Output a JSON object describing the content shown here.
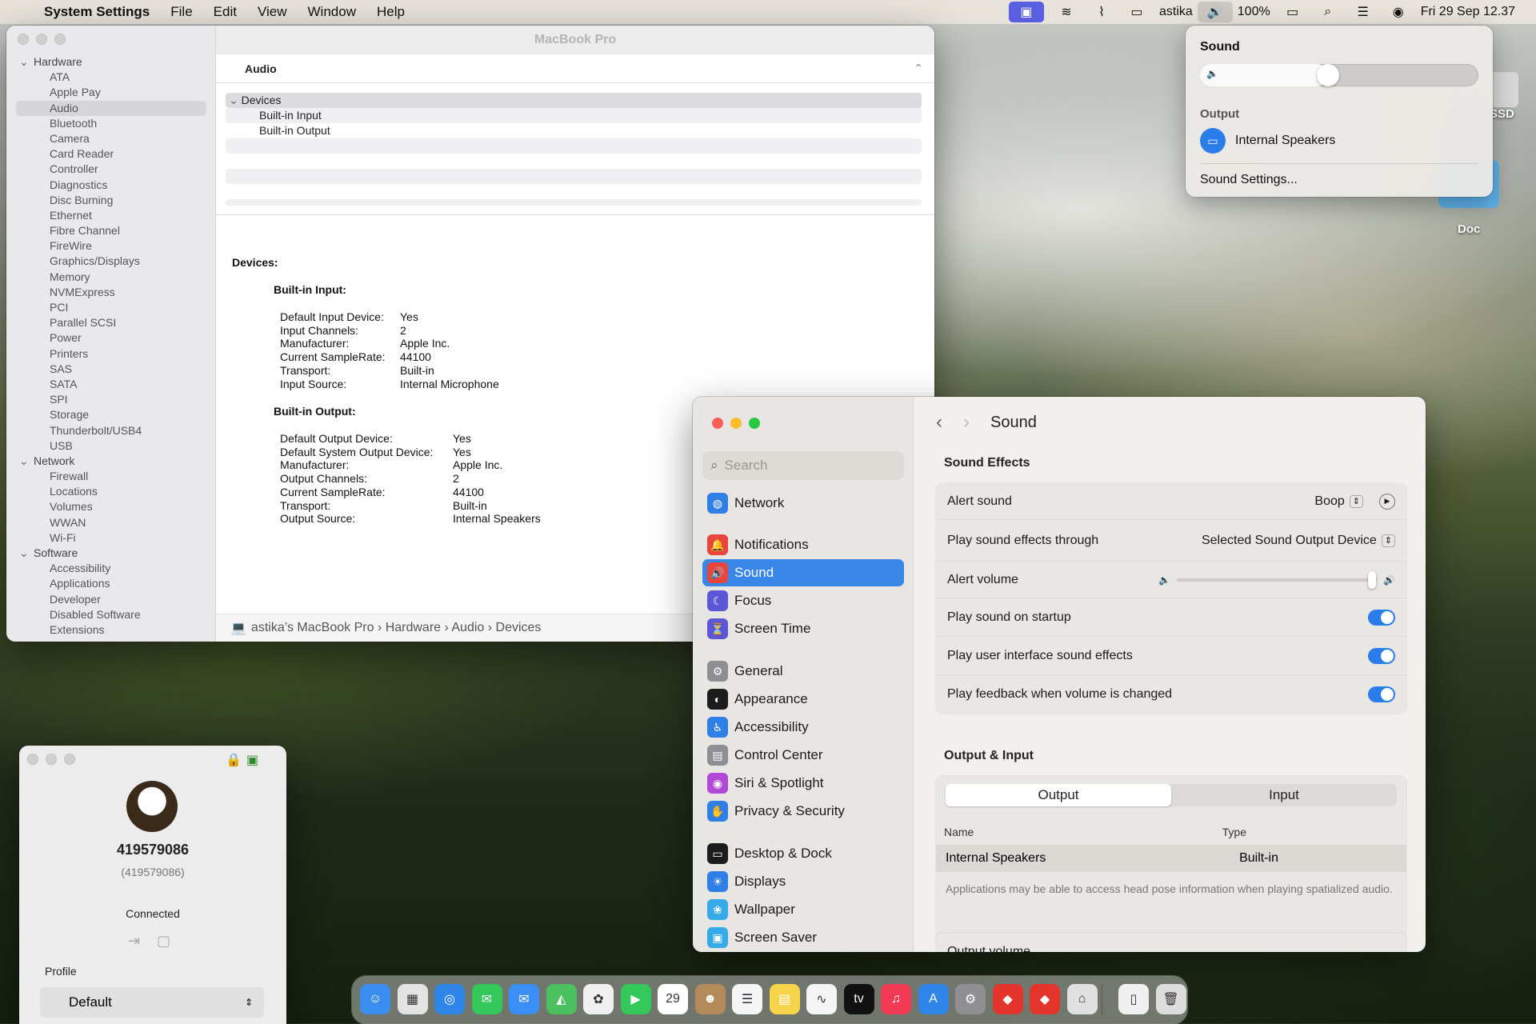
{
  "menubar": {
    "app": "System Settings",
    "items": [
      "File",
      "Edit",
      "Window",
      "Help"
    ],
    "view": "View",
    "user": "astika",
    "battery": "100%",
    "datetime": "Fri 29 Sep  12.37"
  },
  "sound_popup": {
    "title": "Sound",
    "volume": 0.42,
    "output_label": "Output",
    "device": "Internal Speakers",
    "settings_link": "Sound Settings..."
  },
  "desktop": {
    "ssd_label": "SSD",
    "doc_label": "Doc"
  },
  "sysinfo": {
    "window_title": "MacBook Pro",
    "section": "Audio",
    "tree": [
      {
        "t": "Hardware",
        "g": true
      },
      {
        "t": "ATA"
      },
      {
        "t": "Apple Pay"
      },
      {
        "t": "Audio",
        "sel": true
      },
      {
        "t": "Bluetooth"
      },
      {
        "t": "Camera"
      },
      {
        "t": "Card Reader"
      },
      {
        "t": "Controller"
      },
      {
        "t": "Diagnostics"
      },
      {
        "t": "Disc Burning"
      },
      {
        "t": "Ethernet"
      },
      {
        "t": "Fibre Channel"
      },
      {
        "t": "FireWire"
      },
      {
        "t": "Graphics/Displays"
      },
      {
        "t": "Memory"
      },
      {
        "t": "NVMExpress"
      },
      {
        "t": "PCI"
      },
      {
        "t": "Parallel SCSI"
      },
      {
        "t": "Power"
      },
      {
        "t": "Printers"
      },
      {
        "t": "SAS"
      },
      {
        "t": "SATA"
      },
      {
        "t": "SPI"
      },
      {
        "t": "Storage"
      },
      {
        "t": "Thunderbolt/USB4"
      },
      {
        "t": "USB"
      },
      {
        "t": "Network",
        "g": true
      },
      {
        "t": "Firewall"
      },
      {
        "t": "Locations"
      },
      {
        "t": "Volumes"
      },
      {
        "t": "WWAN"
      },
      {
        "t": "Wi-Fi"
      },
      {
        "t": "Software",
        "g": true
      },
      {
        "t": "Accessibility"
      },
      {
        "t": "Applications"
      },
      {
        "t": "Developer"
      },
      {
        "t": "Disabled Software"
      },
      {
        "t": "Extensions"
      }
    ],
    "list": {
      "devices": "Devices",
      "input": "Built-in Input",
      "output": "Built-in Output"
    },
    "detail": {
      "heading": "Devices:",
      "input_title": "Built-in Input:",
      "input_kv": [
        [
          "Default Input Device:",
          "Yes"
        ],
        [
          "Input Channels:",
          "2"
        ],
        [
          "Manufacturer:",
          "Apple Inc."
        ],
        [
          "Current SampleRate:",
          "44100"
        ],
        [
          "Transport:",
          "Built-in"
        ],
        [
          "Input Source:",
          "Internal Microphone"
        ]
      ],
      "output_title": "Built-in Output:",
      "output_kv": [
        [
          "Default Output Device:",
          "Yes"
        ],
        [
          "Default System Output Device:",
          "Yes"
        ],
        [
          "Manufacturer:",
          "Apple Inc."
        ],
        [
          "Output Channels:",
          "2"
        ],
        [
          "Current SampleRate:",
          "44100"
        ],
        [
          "Transport:",
          "Built-in"
        ],
        [
          "Output Source:",
          "Internal Speakers"
        ]
      ]
    },
    "breadcrumb": "astika’s MacBook Pro › Hardware › Audio › Devices"
  },
  "settings": {
    "search_placeholder": "Search",
    "title": "Sound",
    "nav": [
      {
        "label": "Network",
        "color": "#2f7fe6",
        "icon": "globe-icon",
        "glyph": "◍"
      },
      {
        "label": "Notifications",
        "color": "#e8453c",
        "icon": "bell-icon",
        "glyph": "🔔"
      },
      {
        "label": "Sound",
        "color": "#e8453c",
        "icon": "speaker-icon",
        "glyph": "🔊",
        "on": true
      },
      {
        "label": "Focus",
        "color": "#5b57d6",
        "icon": "moon-icon",
        "glyph": "☾"
      },
      {
        "label": "Screen Time",
        "color": "#5b57d6",
        "icon": "hourglass-icon",
        "glyph": "⏳"
      },
      {
        "label": "General",
        "color": "#8e8e93",
        "icon": "gear-icon",
        "glyph": "⚙"
      },
      {
        "label": "Appearance",
        "color": "#1c1c1e",
        "icon": "appearance-icon",
        "glyph": "◐"
      },
      {
        "label": "Accessibility",
        "color": "#2f7fe6",
        "icon": "accessibility-icon",
        "glyph": "♿"
      },
      {
        "label": "Control Center",
        "color": "#8e8e93",
        "icon": "control-center-icon",
        "glyph": "▤"
      },
      {
        "label": "Siri & Spotlight",
        "color": "#b04ad6",
        "icon": "siri-icon",
        "glyph": "◉"
      },
      {
        "label": "Privacy & Security",
        "color": "#2f7fe6",
        "icon": "hand-icon",
        "glyph": "✋"
      },
      {
        "label": "Desktop & Dock",
        "color": "#1c1c1e",
        "icon": "dock-icon",
        "glyph": "▭"
      },
      {
        "label": "Displays",
        "color": "#2f7fe6",
        "icon": "display-icon",
        "glyph": "☀"
      },
      {
        "label": "Wallpaper",
        "color": "#36a9e8",
        "icon": "wallpaper-icon",
        "glyph": "❀"
      },
      {
        "label": "Screen Saver",
        "color": "#36a9e8",
        "icon": "screensaver-icon",
        "glyph": "▣"
      }
    ],
    "effects_title": "Sound Effects",
    "alert_sound": {
      "label": "Alert sound",
      "value": "Boop"
    },
    "play_through": {
      "label": "Play sound effects through",
      "value": "Selected Sound Output Device"
    },
    "alert_volume": {
      "label": "Alert volume",
      "value": 1.0
    },
    "toggles": [
      {
        "label": "Play sound on startup",
        "on": true
      },
      {
        "label": "Play user interface sound effects",
        "on": true
      },
      {
        "label": "Play feedback when volume is changed",
        "on": true
      }
    ],
    "oi_title": "Output & Input",
    "tabs": {
      "output": "Output",
      "input": "Input"
    },
    "table": {
      "col_name": "Name",
      "col_type": "Type",
      "row_name": "Internal Speakers",
      "row_type": "Built-in"
    },
    "note": "Applications may be able to access head pose information when playing spatialized audio.",
    "output_volume": "Output volume"
  },
  "teamviewer": {
    "id": "419579086",
    "id_paren": "(419579086)",
    "status": "Connected",
    "profile_label": "Profile",
    "profile_value": "Default"
  },
  "dock": {
    "apps": [
      {
        "n": "finder-icon",
        "c": "#3b8ef0",
        "g": "☺"
      },
      {
        "n": "launchpad-icon",
        "c": "#e3e3e3",
        "g": "▦"
      },
      {
        "n": "safari-icon",
        "c": "#2f86e8",
        "g": "◎"
      },
      {
        "n": "messages-icon",
        "c": "#34c759",
        "g": "✉"
      },
      {
        "n": "mail-icon",
        "c": "#3a8ef5",
        "g": "✉"
      },
      {
        "n": "maps-icon",
        "c": "#4cbf5f",
        "g": "◭"
      },
      {
        "n": "photos-icon",
        "c": "#f0f0f0",
        "g": "✿"
      },
      {
        "n": "facetime-icon",
        "c": "#34c759",
        "g": "▶"
      },
      {
        "n": "calendar-icon",
        "c": "#ffffff",
        "g": "29"
      },
      {
        "n": "contacts-icon",
        "c": "#b58a5a",
        "g": "☻"
      },
      {
        "n": "reminders-icon",
        "c": "#f5f5f5",
        "g": "☰"
      },
      {
        "n": "notes-icon",
        "c": "#f7d44a",
        "g": "▤"
      },
      {
        "n": "freeform-icon",
        "c": "#f5f5f5",
        "g": "∿"
      },
      {
        "n": "tv-icon",
        "c": "#111111",
        "g": "tv"
      },
      {
        "n": "music-icon",
        "c": "#f33a55",
        "g": "♫"
      },
      {
        "n": "app-store-icon",
        "c": "#2f86e8",
        "g": "A"
      },
      {
        "n": "system-settings-icon",
        "c": "#8e8e93",
        "g": "⚙"
      },
      {
        "n": "anydesk-icon",
        "c": "#e5342b",
        "g": "◆"
      },
      {
        "n": "anydesk-alt-icon",
        "c": "#e5342b",
        "g": "◆"
      },
      {
        "n": "preview-icon",
        "c": "#e0e0e0",
        "g": "⌂"
      },
      {
        "n": "document-icon",
        "c": "#f0f0f0",
        "g": "▯"
      },
      {
        "n": "trash-icon",
        "c": "#dcdcdc",
        "g": "🗑"
      }
    ]
  }
}
